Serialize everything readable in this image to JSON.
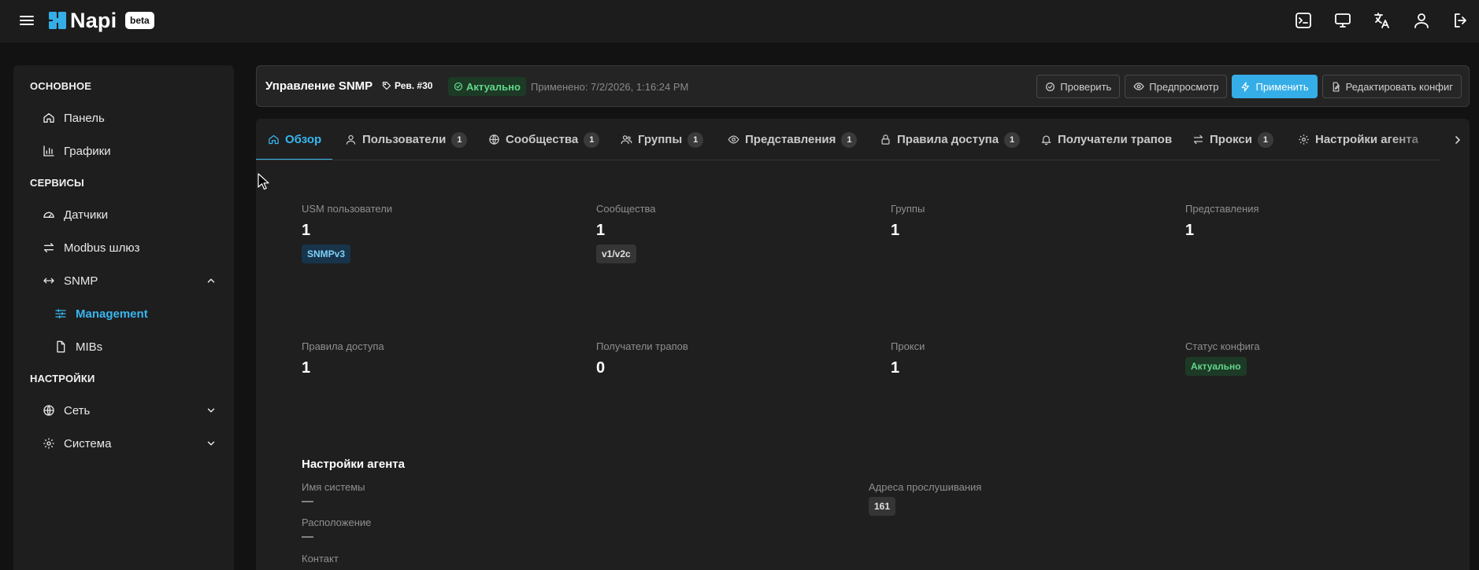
{
  "topbar": {
    "logo_text": "Napi",
    "beta_label": "beta",
    "icons": [
      "terminal-icon",
      "monitor-icon",
      "translate-icon",
      "user-icon",
      "logout-icon"
    ]
  },
  "sidebar": {
    "sections": [
      {
        "title": "ОСНОВНОЕ",
        "items": [
          {
            "label": "Панель",
            "icon": "home-icon"
          },
          {
            "label": "Графики",
            "icon": "bar-chart-icon"
          }
        ]
      },
      {
        "title": "СЕРВИСЫ",
        "items": [
          {
            "label": "Датчики",
            "icon": "gauge-icon"
          },
          {
            "label": "Modbus шлюз",
            "icon": "swap-icon"
          },
          {
            "label": "SNMP",
            "icon": "arrows-horizontal-icon",
            "expanded": true
          },
          {
            "label": "Management",
            "icon": "sliders-icon",
            "active": true
          },
          {
            "label": "MIBs",
            "icon": "file-icon"
          }
        ]
      },
      {
        "title": "НАСТРОЙКИ",
        "items": [
          {
            "label": "Сеть",
            "icon": "globe-icon"
          },
          {
            "label": "Система",
            "icon": "gear-icon"
          }
        ]
      }
    ]
  },
  "header": {
    "title": "Управление SNMP",
    "revision": "Рев. #30",
    "status": "Актуально",
    "applied": "Применено: 7/2/2026, 1:16:24 PM",
    "buttons": {
      "check": "Проверить",
      "preview": "Предпросмотр",
      "apply": "Применить",
      "edit": "Редактировать конфиг"
    }
  },
  "tabs": [
    {
      "label": "Обзор",
      "active": true
    },
    {
      "label": "Пользователи",
      "count": "1"
    },
    {
      "label": "Сообщества",
      "count": "1"
    },
    {
      "label": "Группы",
      "count": "1"
    },
    {
      "label": "Представления",
      "count": "1"
    },
    {
      "label": "Правила доступа",
      "count": "1"
    },
    {
      "label": "Получатели трапов"
    },
    {
      "label": "Прокси",
      "count": "1"
    },
    {
      "label": "Настройки агента"
    }
  ],
  "overview": {
    "stats": [
      {
        "label": "USM пользователи",
        "value": "1",
        "tag": "SNMPv3"
      },
      {
        "label": "Сообщества",
        "value": "1",
        "tag": "v1/v2c"
      },
      {
        "label": "Группы",
        "value": "1"
      },
      {
        "label": "Представления",
        "value": "1"
      },
      {
        "label": "Правила доступа",
        "value": "1"
      },
      {
        "label": "Получатели трапов",
        "value": "0"
      },
      {
        "label": "Прокси",
        "value": "1"
      },
      {
        "label": "Статус конфига",
        "status": "Актуально"
      }
    ],
    "agent": {
      "title": "Настройки агента",
      "system_name_label": "Имя системы",
      "system_name_value": "—",
      "location_label": "Расположение",
      "location_value": "—",
      "contact_label": "Контакт",
      "listen_label": "Адреса прослушивания",
      "listen_value": "161"
    }
  },
  "colors": {
    "accent": "#38b6f0",
    "success": "#62d78a",
    "background": "#121212",
    "surface": "#1f1f1f"
  }
}
